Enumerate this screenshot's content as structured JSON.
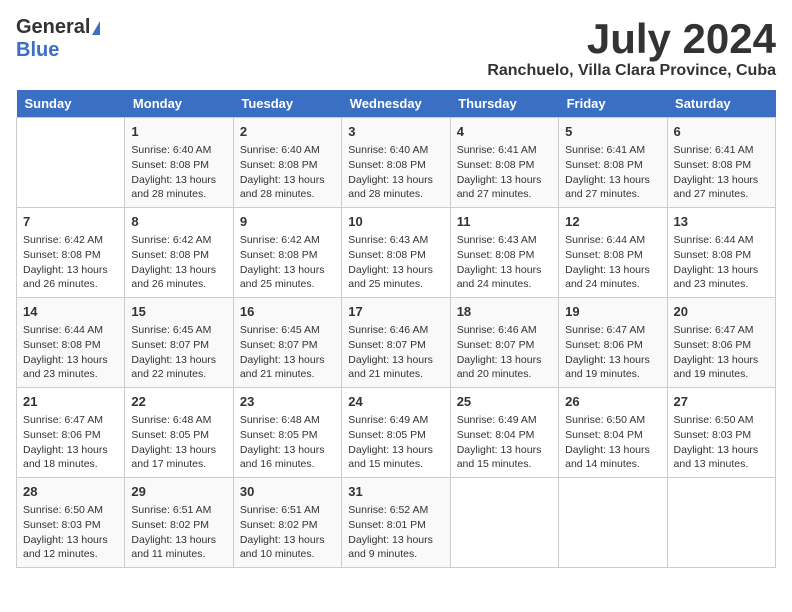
{
  "header": {
    "logo_general": "General",
    "logo_blue": "Blue",
    "title": "July 2024",
    "subtitle": "Ranchuelo, Villa Clara Province, Cuba"
  },
  "days_of_week": [
    "Sunday",
    "Monday",
    "Tuesday",
    "Wednesday",
    "Thursday",
    "Friday",
    "Saturday"
  ],
  "weeks": [
    [
      {
        "day": "",
        "info": ""
      },
      {
        "day": "1",
        "info": "Sunrise: 6:40 AM\nSunset: 8:08 PM\nDaylight: 13 hours and 28 minutes."
      },
      {
        "day": "2",
        "info": "Sunrise: 6:40 AM\nSunset: 8:08 PM\nDaylight: 13 hours and 28 minutes."
      },
      {
        "day": "3",
        "info": "Sunrise: 6:40 AM\nSunset: 8:08 PM\nDaylight: 13 hours and 28 minutes."
      },
      {
        "day": "4",
        "info": "Sunrise: 6:41 AM\nSunset: 8:08 PM\nDaylight: 13 hours and 27 minutes."
      },
      {
        "day": "5",
        "info": "Sunrise: 6:41 AM\nSunset: 8:08 PM\nDaylight: 13 hours and 27 minutes."
      },
      {
        "day": "6",
        "info": "Sunrise: 6:41 AM\nSunset: 8:08 PM\nDaylight: 13 hours and 27 minutes."
      }
    ],
    [
      {
        "day": "7",
        "info": "Sunrise: 6:42 AM\nSunset: 8:08 PM\nDaylight: 13 hours and 26 minutes."
      },
      {
        "day": "8",
        "info": "Sunrise: 6:42 AM\nSunset: 8:08 PM\nDaylight: 13 hours and 26 minutes."
      },
      {
        "day": "9",
        "info": "Sunrise: 6:42 AM\nSunset: 8:08 PM\nDaylight: 13 hours and 25 minutes."
      },
      {
        "day": "10",
        "info": "Sunrise: 6:43 AM\nSunset: 8:08 PM\nDaylight: 13 hours and 25 minutes."
      },
      {
        "day": "11",
        "info": "Sunrise: 6:43 AM\nSunset: 8:08 PM\nDaylight: 13 hours and 24 minutes."
      },
      {
        "day": "12",
        "info": "Sunrise: 6:44 AM\nSunset: 8:08 PM\nDaylight: 13 hours and 24 minutes."
      },
      {
        "day": "13",
        "info": "Sunrise: 6:44 AM\nSunset: 8:08 PM\nDaylight: 13 hours and 23 minutes."
      }
    ],
    [
      {
        "day": "14",
        "info": "Sunrise: 6:44 AM\nSunset: 8:08 PM\nDaylight: 13 hours and 23 minutes."
      },
      {
        "day": "15",
        "info": "Sunrise: 6:45 AM\nSunset: 8:07 PM\nDaylight: 13 hours and 22 minutes."
      },
      {
        "day": "16",
        "info": "Sunrise: 6:45 AM\nSunset: 8:07 PM\nDaylight: 13 hours and 21 minutes."
      },
      {
        "day": "17",
        "info": "Sunrise: 6:46 AM\nSunset: 8:07 PM\nDaylight: 13 hours and 21 minutes."
      },
      {
        "day": "18",
        "info": "Sunrise: 6:46 AM\nSunset: 8:07 PM\nDaylight: 13 hours and 20 minutes."
      },
      {
        "day": "19",
        "info": "Sunrise: 6:47 AM\nSunset: 8:06 PM\nDaylight: 13 hours and 19 minutes."
      },
      {
        "day": "20",
        "info": "Sunrise: 6:47 AM\nSunset: 8:06 PM\nDaylight: 13 hours and 19 minutes."
      }
    ],
    [
      {
        "day": "21",
        "info": "Sunrise: 6:47 AM\nSunset: 8:06 PM\nDaylight: 13 hours and 18 minutes."
      },
      {
        "day": "22",
        "info": "Sunrise: 6:48 AM\nSunset: 8:05 PM\nDaylight: 13 hours and 17 minutes."
      },
      {
        "day": "23",
        "info": "Sunrise: 6:48 AM\nSunset: 8:05 PM\nDaylight: 13 hours and 16 minutes."
      },
      {
        "day": "24",
        "info": "Sunrise: 6:49 AM\nSunset: 8:05 PM\nDaylight: 13 hours and 15 minutes."
      },
      {
        "day": "25",
        "info": "Sunrise: 6:49 AM\nSunset: 8:04 PM\nDaylight: 13 hours and 15 minutes."
      },
      {
        "day": "26",
        "info": "Sunrise: 6:50 AM\nSunset: 8:04 PM\nDaylight: 13 hours and 14 minutes."
      },
      {
        "day": "27",
        "info": "Sunrise: 6:50 AM\nSunset: 8:03 PM\nDaylight: 13 hours and 13 minutes."
      }
    ],
    [
      {
        "day": "28",
        "info": "Sunrise: 6:50 AM\nSunset: 8:03 PM\nDaylight: 13 hours and 12 minutes."
      },
      {
        "day": "29",
        "info": "Sunrise: 6:51 AM\nSunset: 8:02 PM\nDaylight: 13 hours and 11 minutes."
      },
      {
        "day": "30",
        "info": "Sunrise: 6:51 AM\nSunset: 8:02 PM\nDaylight: 13 hours and 10 minutes."
      },
      {
        "day": "31",
        "info": "Sunrise: 6:52 AM\nSunset: 8:01 PM\nDaylight: 13 hours and 9 minutes."
      },
      {
        "day": "",
        "info": ""
      },
      {
        "day": "",
        "info": ""
      },
      {
        "day": "",
        "info": ""
      }
    ]
  ]
}
